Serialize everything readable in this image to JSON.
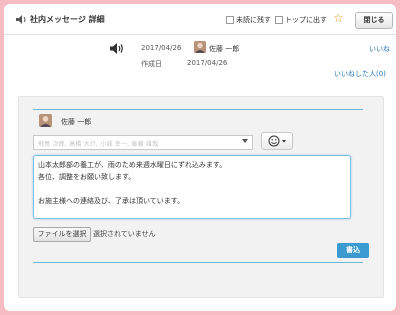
{
  "header": {
    "title": "社内メッセージ 詳細",
    "keep_unread_label": "未読に残す",
    "pin_top_label": "トップに出す",
    "close_label": "閉じる"
  },
  "message": {
    "date": "2017/04/26",
    "sender_name": "佐藤 一郎",
    "created_label": "作成日",
    "created_date": "2017/04/26",
    "like_label": "いいね",
    "liked_by_label": "いいねした人(0)"
  },
  "reply": {
    "author_name": "佐藤 一郎",
    "recipients": "飛鳥 次郎, 高橋 大介, 小城 幸一, 泰藤 雄哉",
    "body_lines": [
      "山本太郎部の養工が、雨のため来週水曜日にずれ込みます。",
      "各位、調整をお願い致します。",
      "",
      "お施主様への連絡及び、了承は頂いています。"
    ],
    "choose_file_label": "ファイルを選択",
    "no_file_label": "選択されていません",
    "post_label": "書込"
  },
  "colors": {
    "page_background": "#f6bcc3",
    "accent_blue": "#3b9bd0",
    "link_blue": "#2a7ab8",
    "star": "#e0a020"
  }
}
